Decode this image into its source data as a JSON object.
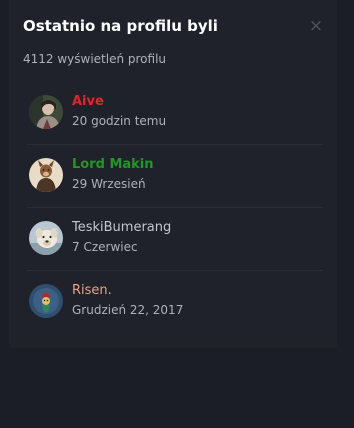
{
  "panel": {
    "title": "Ostatnio na profilu byli",
    "close_icon": "close-icon",
    "close_glyph": "×",
    "views": "4112 wyświetleń profilu"
  },
  "visitors": [
    {
      "name": "Aive",
      "date": "20 godzin temu",
      "name_color": "#e8212b",
      "bold": true,
      "avatar": "user-avatar"
    },
    {
      "name": "Lord Makin",
      "date": "29 Wrzesień",
      "name_color": "#1e9a22",
      "bold": true,
      "avatar": "user-avatar"
    },
    {
      "name": "TeskiBumerang",
      "date": "7 Czerwiec",
      "name_color": "#c3c6ce",
      "bold": false,
      "avatar": "user-avatar"
    },
    {
      "name": "Risen.",
      "date": "Grudzień 22, 2017",
      "name_color": "#e5a488",
      "bold": false,
      "avatar": "user-avatar"
    }
  ]
}
